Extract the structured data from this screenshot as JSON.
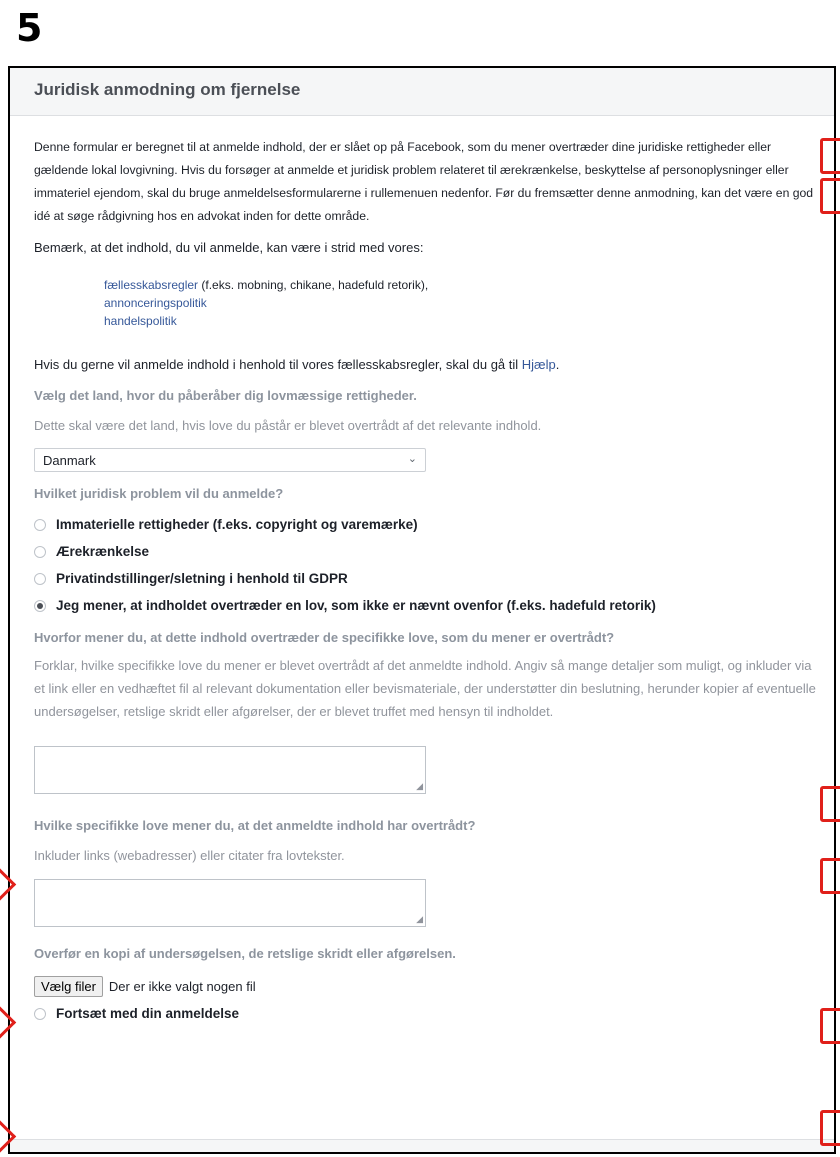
{
  "step_number": "5",
  "panel": {
    "title": "Juridisk anmodning om fjernelse"
  },
  "intro": "Denne formular er beregnet til at anmelde indhold, der er slået op på Facebook, som du mener overtræder dine juridiske rettigheder eller gældende lokal lovgivning. Hvis du forsøger at anmelde et juridisk problem relateret til ærekrænkelse, beskyttelse af personoplysninger eller immateriel ejendom, skal du bruge anmeldelsesformularerne i rullemenuen nedenfor. Før du fremsætter denne anmodning, kan det være en god idé at søge rådgivning hos en advokat inden for dette område.",
  "note": "Bemærk, at det indhold, du vil anmelde, kan være i strid med vores:",
  "policies": [
    {
      "link": "fællesskabsregler",
      "rest": " (f.eks. mobning, chikane, hadefuld retorik),"
    },
    {
      "link": "annonceringspolitik",
      "rest": ""
    },
    {
      "link": "handelspolitik",
      "rest": ""
    }
  ],
  "help": {
    "text": "Hvis du gerne vil anmelde indhold i henhold til vores fællesskabsregler, skal du gå til ",
    "link": "Hjælp",
    "end": "."
  },
  "country": {
    "label": "Vælg det land, hvor du påberåber dig lovmæssige rettigheder.",
    "hint": "Dette skal være det land, hvis love du påstår er blevet overtrådt af det relevante indhold.",
    "selected": "Danmark"
  },
  "problem": {
    "label": "Hvilket juridisk problem vil du anmelde?",
    "options": [
      {
        "label": "Immaterielle rettigheder (f.eks. copyright og varemærke)",
        "checked": false
      },
      {
        "label": "Ærekrænkelse",
        "checked": false
      },
      {
        "label": "Privatindstillinger/sletning i henhold til GDPR",
        "checked": false
      },
      {
        "label": "Jeg mener, at indholdet overtræder en lov, som ikke er nævnt ovenfor (f.eks. hadefuld retorik)",
        "checked": true
      }
    ]
  },
  "why": {
    "label": "Hvorfor mener du, at dette indhold overtræder de specifikke love, som du mener er overtrådt?",
    "hint": "Forklar, hvilke specifikke love du mener er blevet overtrådt af det anmeldte indhold. Angiv så mange detaljer som muligt, og inkluder via et link eller en vedhæftet fil al relevant dokumentation eller bevismateriale, der understøtter din beslutning, herunder kopier af eventuelle undersøgelser, retslige skridt eller afgørelser, der er blevet truffet med hensyn til indholdet."
  },
  "laws": {
    "label": "Hvilke specifikke love mener du, at det anmeldte indhold har overtrådt?",
    "hint": "Inkluder links (webadresser) eller citater fra lovtekster."
  },
  "upload": {
    "label": "Overfør en kopi af undersøgelsen, de retslige skridt eller afgørelsen.",
    "button": "Vælg filer",
    "status": "Der er ikke valgt nogen fil"
  },
  "continue": {
    "label": "Fortsæt med din anmeldelse",
    "checked": false
  },
  "colors": {
    "annotation": "#e0201a",
    "link": "#365899"
  }
}
